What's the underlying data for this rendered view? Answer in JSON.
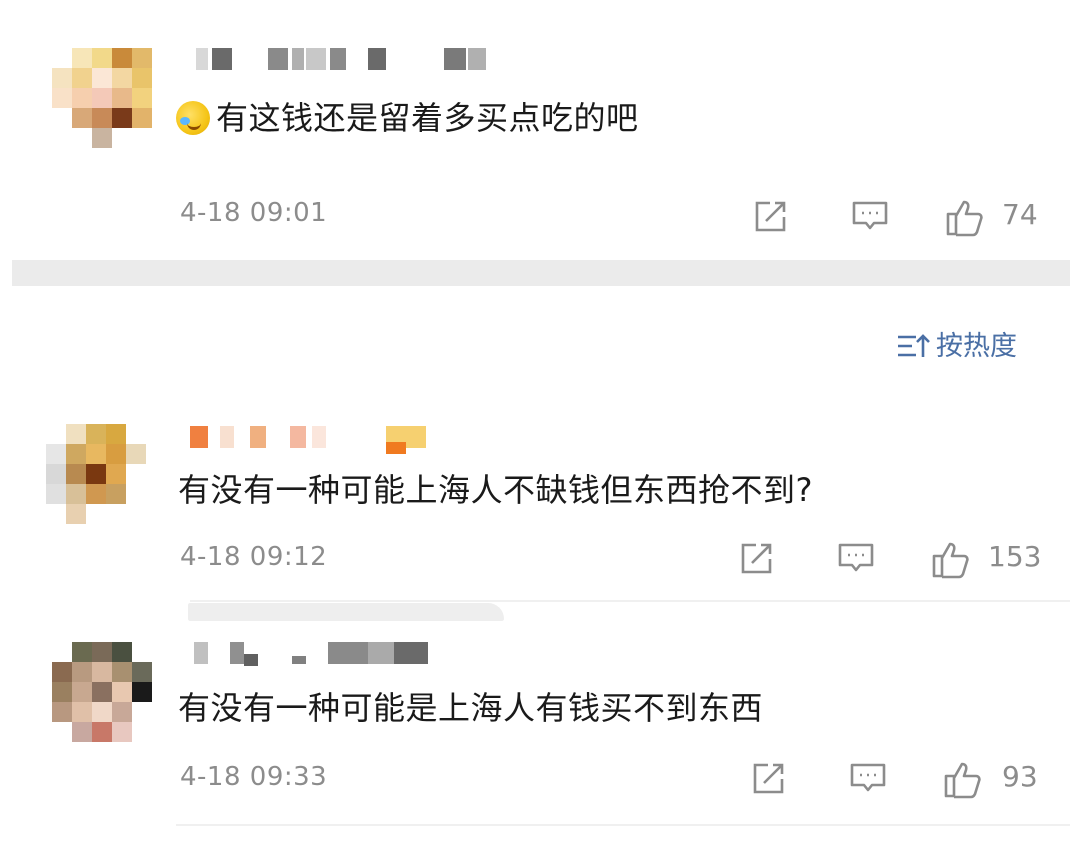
{
  "top_comment": {
    "text": "有这钱还是留着多买点吃的吧",
    "time": "4-18 09:01",
    "likes": "74"
  },
  "sort": {
    "label": "按热度"
  },
  "comments": [
    {
      "text": "有没有一种可能上海人不缺钱但东西抢不到?",
      "time": "4-18 09:12",
      "likes": "153"
    },
    {
      "text": "有没有一种可能是上海人有钱买不到东西",
      "time": "4-18 09:33",
      "likes": "93"
    }
  ],
  "icons": {
    "emoji": "laughing-crying-emoji-icon",
    "repost": "repost-icon",
    "reply": "comment-icon",
    "like": "thumbs-up-icon",
    "sort": "sort-icon"
  },
  "colors": {
    "link": "#4a6fa5",
    "meta": "#8c8c8c",
    "divider": "#ebebeb"
  }
}
